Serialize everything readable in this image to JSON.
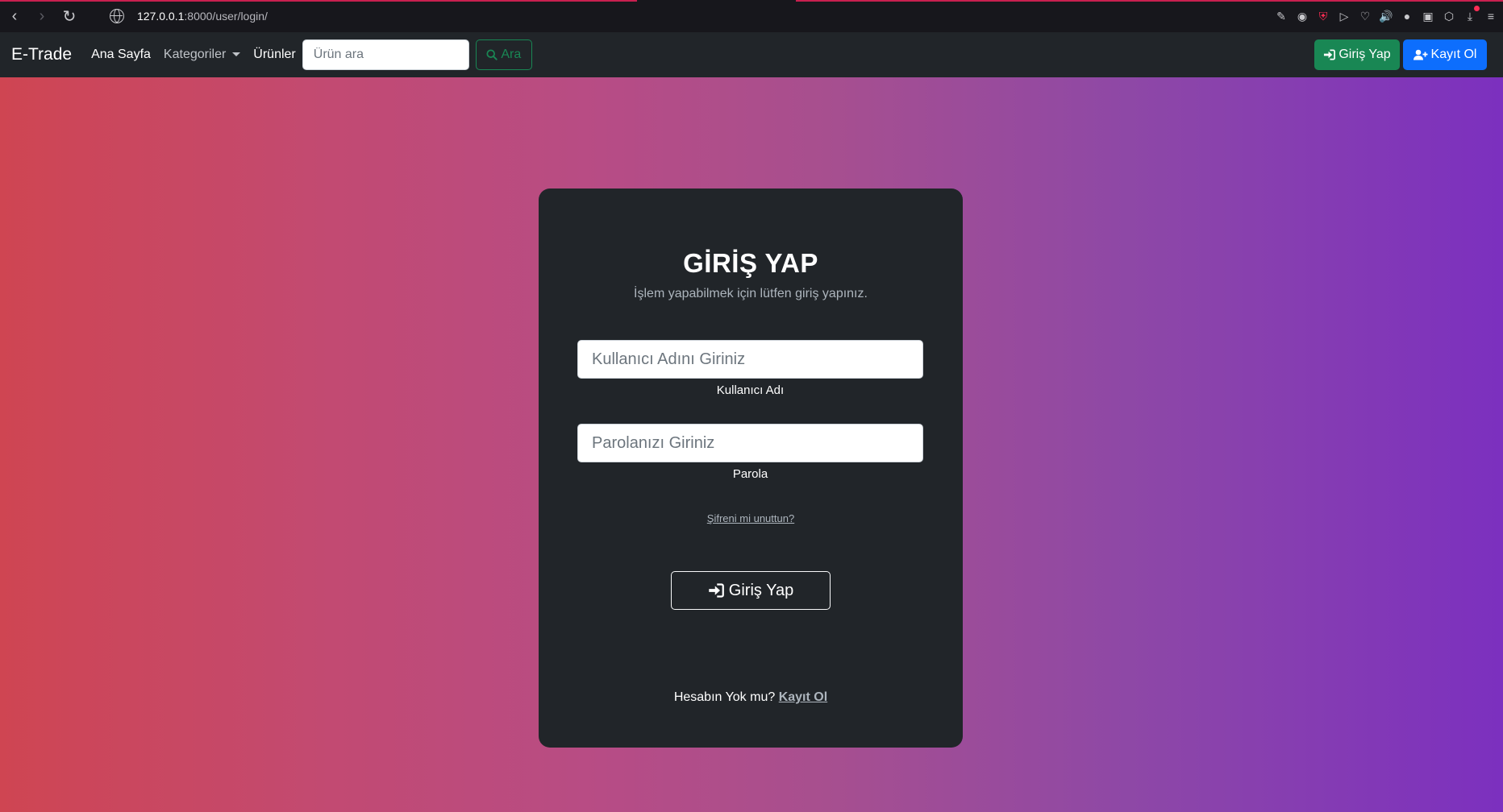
{
  "browser": {
    "url_host": "127.0.0.1",
    "url_path": ":8000/user/login/"
  },
  "navbar": {
    "brand": "E-Trade",
    "links": {
      "home": "Ana Sayfa",
      "categories": "Kategoriler",
      "products": "Ürünler"
    },
    "search": {
      "placeholder": "Ürün ara",
      "button_label": "Ara"
    },
    "login_label": "Giriş Yap",
    "register_label": "Kayıt Ol"
  },
  "login_card": {
    "title": "GİRİŞ YAP",
    "subtitle": "İşlem yapabilmek için lütfen giriş yapınız.",
    "username": {
      "placeholder": "Kullanıcı Adını Giriniz",
      "label": "Kullanıcı Adı"
    },
    "password": {
      "placeholder": "Parolanızı Giriniz",
      "label": "Parola"
    },
    "forgot_link": "Şifreni mi unuttun?",
    "submit_label": "Giriş Yap",
    "no_account_text": "Hesabın Yok mu?",
    "register_link": "Kayıt Ol"
  },
  "colors": {
    "navbar_bg": "#212529",
    "success": "#198754",
    "primary": "#0d6efd",
    "gradient_start": "#cf4552",
    "gradient_end": "#7c30bf"
  }
}
